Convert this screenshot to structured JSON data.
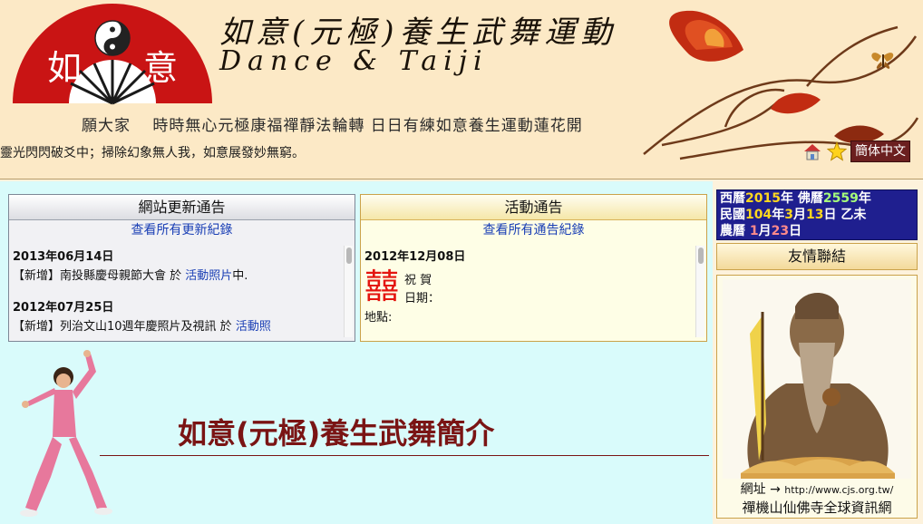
{
  "header": {
    "fan_left_char": "如",
    "fan_right_char": "意",
    "title_main": "如意(元極)養生武舞運動",
    "title_sub": "Dance & Taiji",
    "motto": "願大家　 時時無心元極康福禪靜法輪轉 日日有練如意養生運動蓮花開",
    "marquee": "靈光閃閃破爻中；掃除幻象無人我，如意展發妙無窮。",
    "lang_button": "簡体中文",
    "icons": [
      "home-icon",
      "star-icon"
    ]
  },
  "updates_panel": {
    "title": "網站更新通告",
    "link": "查看所有更新紀錄",
    "entries": [
      {
        "date": "2013年06月14日",
        "prefix": "【新增】南投縣慶母親節大會 於 ",
        "link": "活動照片",
        "suffix": "中."
      },
      {
        "date": "2012年07月25日",
        "prefix": "【新增】列治文山10週年慶照片及視訊 於 ",
        "link": "活動照",
        "suffix": ""
      }
    ]
  },
  "events_panel": {
    "title": "活動通告",
    "link": "查看所有通告紀錄",
    "date": "2012年12月08日",
    "xi_char": "囍",
    "congrats": "祝 賀",
    "date_label": "日期：",
    "place_label": "地點:"
  },
  "intro": {
    "title": "如意(元極)養生武舞簡介"
  },
  "calendar": {
    "w_label": "西曆",
    "w_year": "2015",
    "w_year_unit": "年 ",
    "b_label": "佛曆",
    "b_year": "2559",
    "b_year_unit": "年",
    "r_label": "民國",
    "r_year": "104",
    "r_year_unit": "年",
    "r_month": "3",
    "r_month_unit": "月",
    "r_day": "13",
    "r_day_unit": "日 ",
    "ganzhi": "乙未",
    "l_label": "農曆 ",
    "l_month": "1",
    "l_month_unit": "月",
    "l_day": "23",
    "l_day_unit": "日"
  },
  "friends": {
    "title": "友情聯結",
    "site_label": "網址 → ",
    "site_url": "http://www.cjs.org.tw/",
    "site_name": "禪機山仙佛寺全球資訊網"
  },
  "colors": {
    "fan_red": "#c91414",
    "intro_title": "#7a1414",
    "main_bg": "#d9fbfb",
    "header_bg": "#fce9c6",
    "calendar_bg": "#1f1f8f",
    "link_blue": "#1a3fb5"
  }
}
